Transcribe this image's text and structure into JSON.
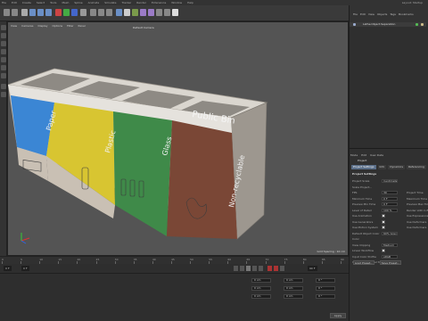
{
  "menubar": {
    "items": [
      "File",
      "Edit",
      "Create",
      "Select",
      "Tools",
      "Mesh",
      "Spline",
      "Animate",
      "Simulate",
      "Tracker",
      "Render",
      "Extensions",
      "Window",
      "Help"
    ],
    "layout_label": "Layout: Startup"
  },
  "viewport": {
    "menu": [
      "View",
      "Cameras",
      "Display",
      "Options",
      "Filter",
      "Panel"
    ],
    "camera": "Default Camera",
    "grid_spacing": "Grid Spacing : 10 cm"
  },
  "model": {
    "top_text": "Public Bin",
    "panels": [
      {
        "label": "Paper",
        "color": "#3b86d4"
      },
      {
        "label": "Plastic",
        "color": "#d8c531"
      },
      {
        "label": "Glass",
        "color": "#3f8a49"
      },
      {
        "label": "Non-recyclable",
        "color": "#7a4736"
      }
    ],
    "body_color": "#c9c0b4",
    "accent_color": "#e0dfd8"
  },
  "timeline": {
    "ticks": [
      "0",
      "5",
      "10",
      "15",
      "20",
      "25",
      "30",
      "35",
      "40",
      "45",
      "50",
      "55",
      "60",
      "65",
      "70",
      "75",
      "80",
      "85",
      "90"
    ],
    "frame_start": "0 F",
    "frame_current": "0 F",
    "frame_end": "90 F"
  },
  "coordinates": {
    "rows": [
      {
        "pos": "0 cm",
        "size": "0 cm",
        "rot": "0 °"
      },
      {
        "pos": "0 cm",
        "size": "0 cm",
        "rot": "0 °"
      },
      {
        "pos": "0 cm",
        "size": "0 cm",
        "rot": "0 °"
      }
    ],
    "apply": "Apply"
  },
  "object_manager": {
    "menu": [
      "File",
      "Edit",
      "View",
      "Objects",
      "Tags",
      "Bookmarks"
    ],
    "object_name": "Lathe.Object.Separation"
  },
  "attributes": {
    "menu": [
      "Mode",
      "Edit",
      "User Data"
    ],
    "title": "Project",
    "tabs": [
      "Project Settings",
      "Info",
      "Dynamics",
      "Referencing",
      "To Do"
    ],
    "section": "Project Settings",
    "props": [
      {
        "label": "Project Scale",
        "value": "Centimeters"
      },
      {
        "label": "Scale Project...",
        "value": ""
      },
      {
        "label": "FPS",
        "value": "30"
      },
      {
        "label": "Minimum Time",
        "value": "0 F"
      },
      {
        "label": "Preview Min Time",
        "value": "0 F"
      },
      {
        "label": "Level of Detail",
        "value": "100 %"
      },
      {
        "label": "Use Animation",
        "value": "check"
      },
      {
        "label": "Use Generators",
        "value": "check"
      },
      {
        "label": "Use Motion System",
        "value": "check"
      },
      {
        "label": "Default Object Color",
        "value": "60% Gray"
      },
      {
        "label": "Color",
        "value": ""
      },
      {
        "label": "View Clipping",
        "value": "Medium"
      },
      {
        "label": "Linear Workflow",
        "value": "check"
      },
      {
        "label": "Input Color Profile",
        "value": "sRGB"
      },
      {
        "label": "Use Color Channel for Node Material",
        "value": ""
      }
    ],
    "right_props": [
      "Project Time",
      "Maximum Time",
      "Preview Max Time",
      "Render LOD in Editor",
      "Use Expressions",
      "Use Deformers",
      "Use Deformers"
    ],
    "buttons": [
      "Load Preset...",
      "Save Preset..."
    ]
  }
}
